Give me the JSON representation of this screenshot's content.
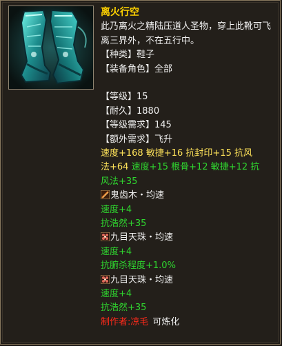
{
  "item": {
    "name": "离火行空",
    "description": "此乃离火之精陆压道人圣物，穿上此靴可飞离三界外，不在五行中。",
    "icon": "boots-icon",
    "info": [
      {
        "label": "【种类】",
        "value": "鞋子"
      },
      {
        "label": "【装备角色】",
        "value": "全部"
      }
    ],
    "attributes": [
      {
        "label": "【等级】",
        "value": "15"
      },
      {
        "label": "【耐久】",
        "value": "1880"
      },
      {
        "label": "【等级需求】",
        "value": "145"
      },
      {
        "label": "【额外需求】",
        "value": "飞升"
      }
    ],
    "base_stats": {
      "line1": "速度+168  敏捷+16  抗封印+15  抗风",
      "line2_yellow": "法+64",
      "line2_green": "  速度+15  根骨+12  敏捷+12  抗",
      "line3": "风法+35"
    },
    "gems": [
      {
        "icon": "wood-gem-icon",
        "name": "鬼齿木・均速",
        "effects": [
          "速度+4",
          "抗浩然+35"
        ]
      },
      {
        "icon": "pearl-gem-icon",
        "name": "九目天珠・均速",
        "effects": [
          "速度+4",
          "抗腑杀程度+1.0%"
        ]
      },
      {
        "icon": "pearl-gem-icon",
        "name": "九目天珠・均速",
        "effects": [
          "速度+4",
          "抗浩然+35"
        ]
      }
    ],
    "maker": {
      "label": "制作者:",
      "name": "凉毛",
      "refinable": "可炼化"
    }
  },
  "colors": {
    "title": "#ffd200",
    "stat_yellow": "#ffe35a",
    "stat_green": "#2fd62f",
    "maker_red": "#ff2a1a",
    "background": "#231f1a",
    "border": "#8a7a60"
  }
}
